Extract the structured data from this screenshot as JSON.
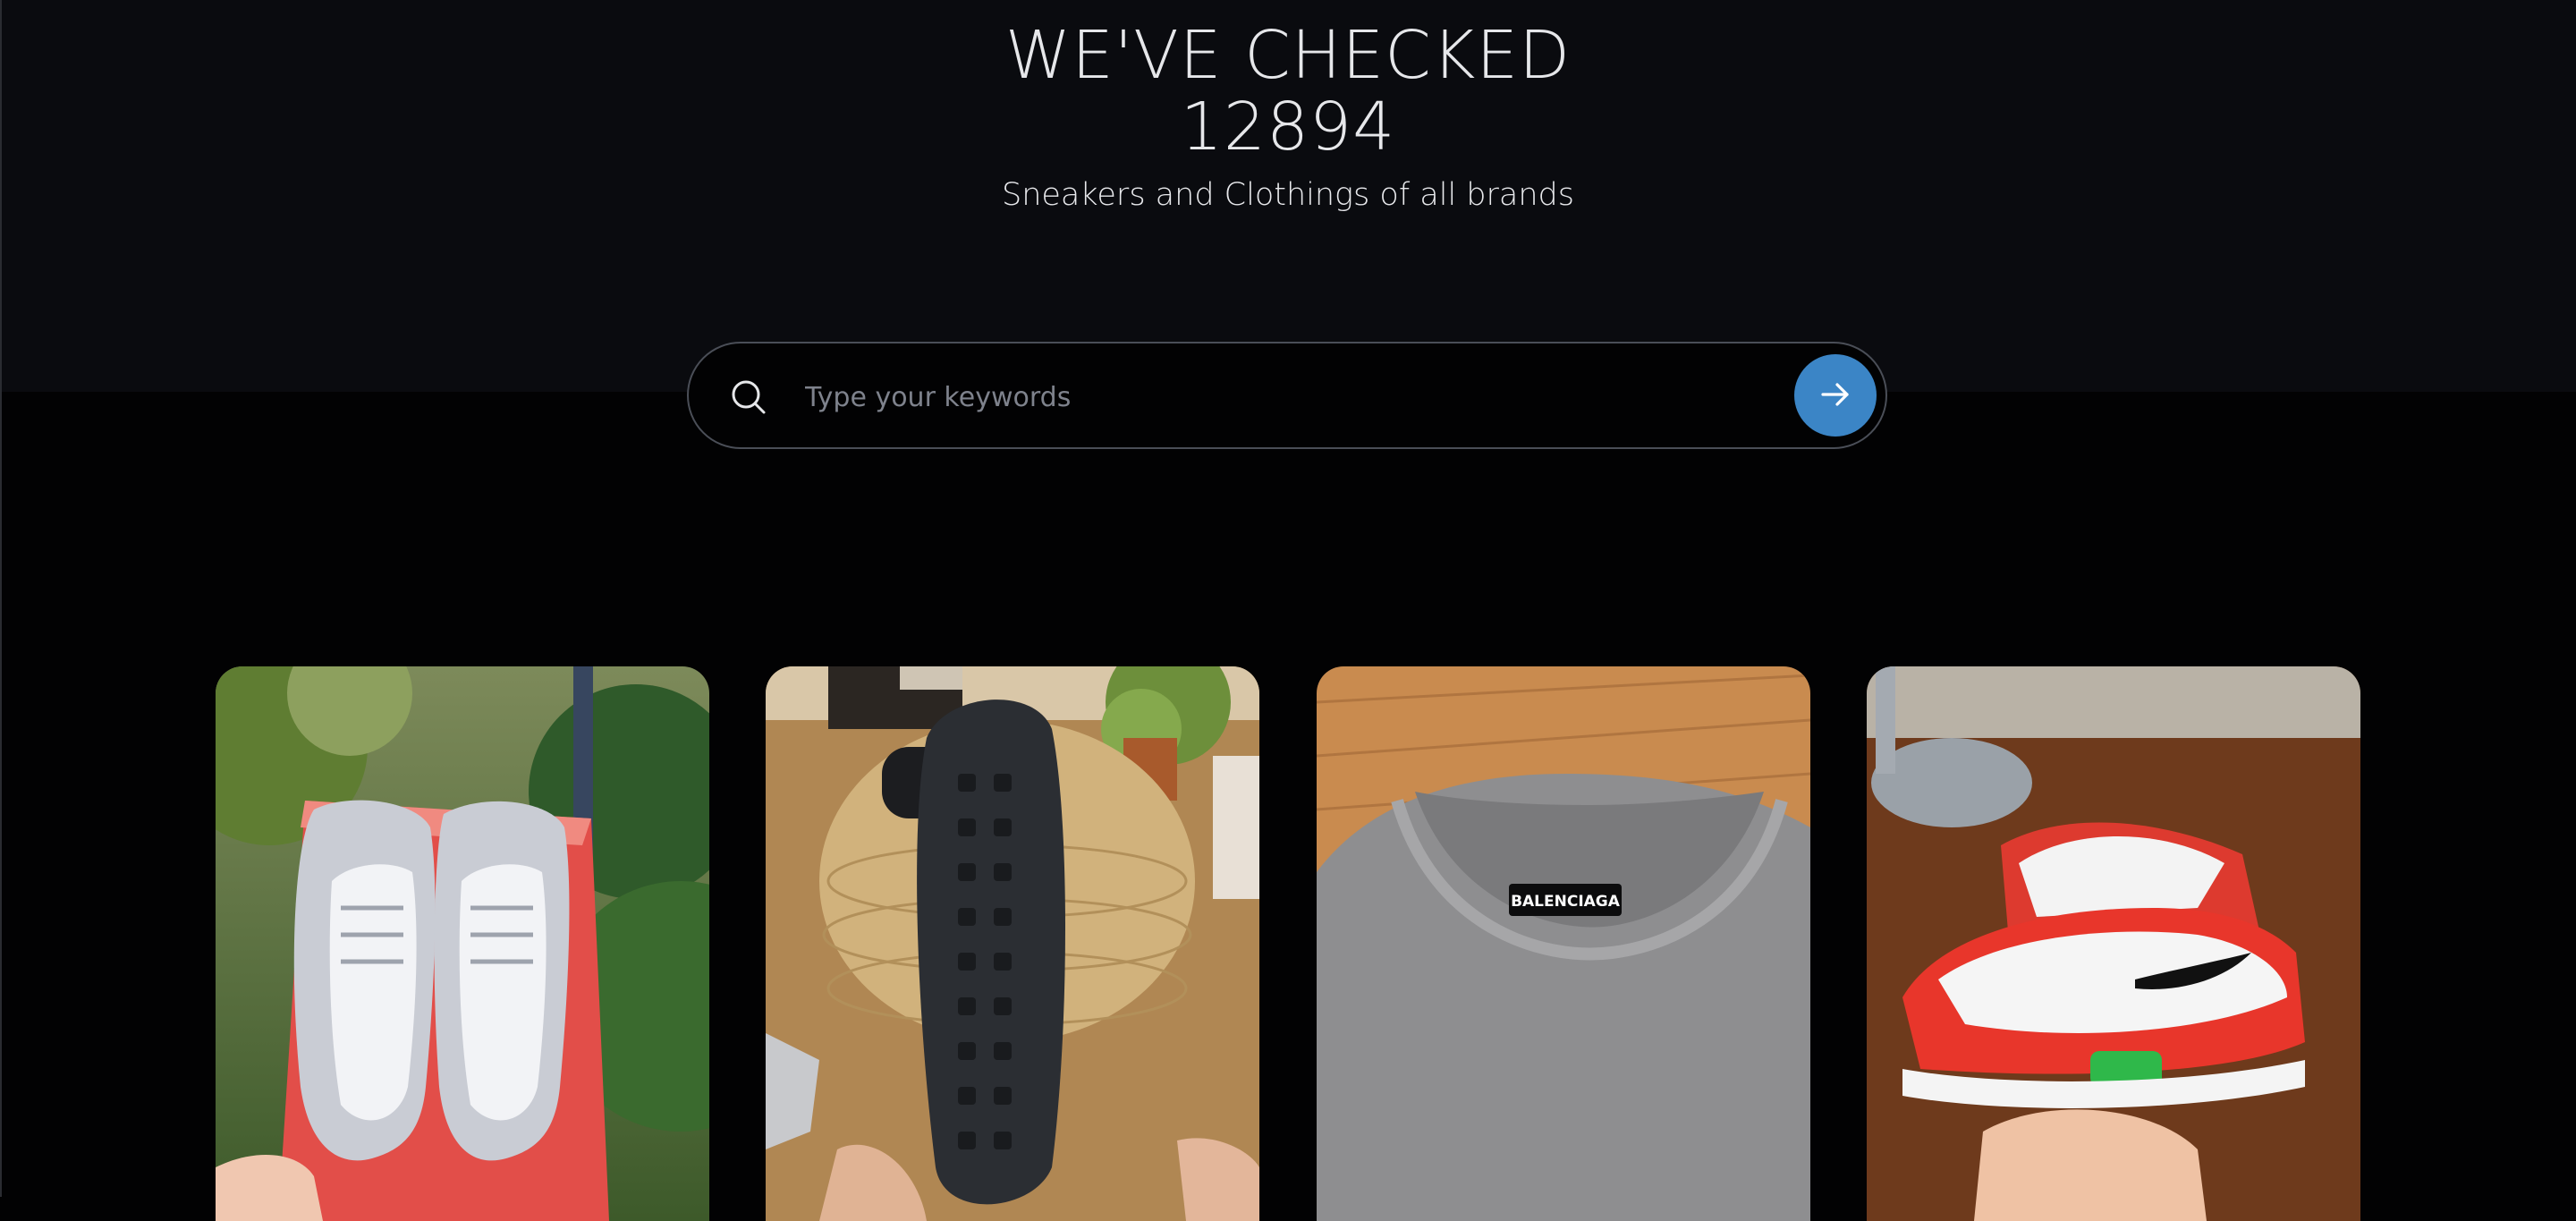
{
  "hero": {
    "headline_line1": "WE'VE CHECKED",
    "headline_line2": "12894",
    "subtitle": "Sneakers and Clothings of all brands"
  },
  "search": {
    "placeholder": "Type your keywords",
    "value": "",
    "icon": "search-icon",
    "submit_icon": "arrow-right-icon"
  },
  "colors": {
    "background": "#020203",
    "hero_band": "#0a0b0f",
    "accent": "#3b85c6"
  },
  "gallery": [
    {
      "name": "white-grey-sneakers-on-box-photo",
      "label": ""
    },
    {
      "name": "black-sneaker-outsole-photo",
      "label": ""
    },
    {
      "name": "grey-tshirt-collar-photo",
      "label": "BALENCIAGA"
    },
    {
      "name": "red-white-sneakers-photo",
      "label": ""
    }
  ]
}
